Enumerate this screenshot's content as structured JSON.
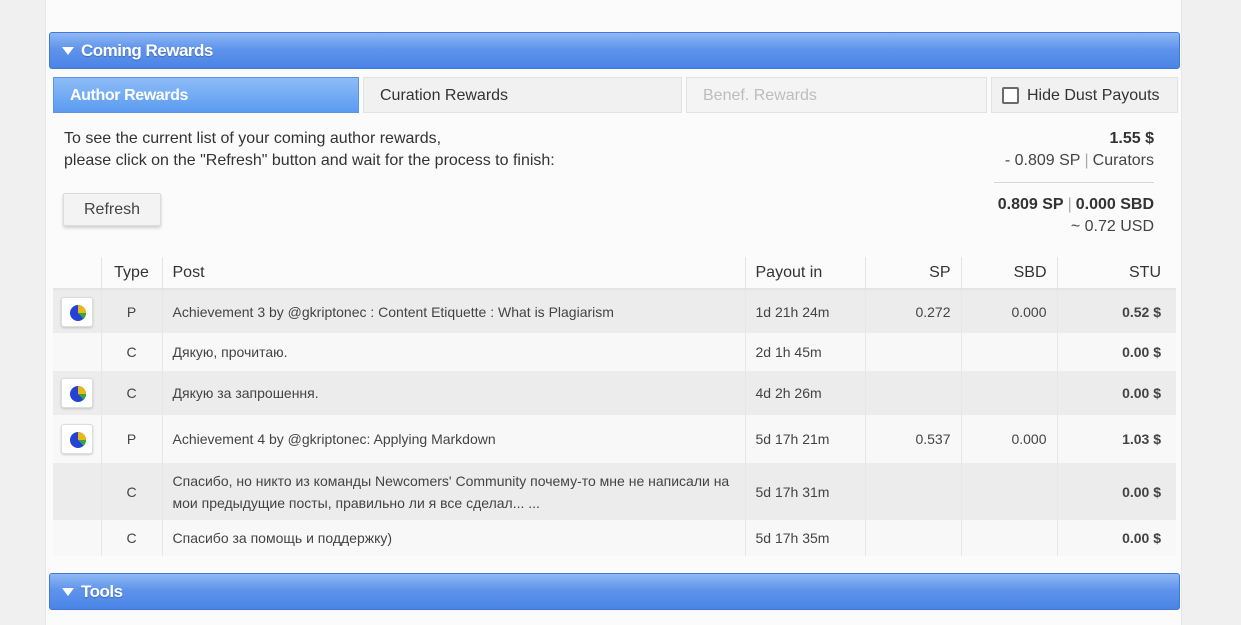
{
  "sections": {
    "coming_rewards": "Coming Rewards",
    "tools": "Tools"
  },
  "tabs": {
    "author": "Author Rewards",
    "curation": "Curation Rewards",
    "benef": "Benef. Rewards",
    "hide_dust": "Hide Dust Payouts"
  },
  "info": {
    "line1": "To see the current list of your coming author rewards,",
    "line2": "please click on the \"Refresh\" button and wait for the process to finish:"
  },
  "refresh_label": "Refresh",
  "totals": {
    "total_usd": "1.55 $",
    "curators_sp": "- 0.809 SP",
    "curators_label": "Curators",
    "sp": "0.809 SP",
    "sbd": "0.000 SBD",
    "usd_approx": "~ 0.72 USD"
  },
  "table": {
    "headers": {
      "type": "Type",
      "post": "Post",
      "payout": "Payout in",
      "sp": "SP",
      "sbd": "SBD",
      "stu": "STU"
    },
    "rows": [
      {
        "icon": "pie-chart-icon",
        "type": "P",
        "post": "Achievement 3 by @gkriptonec : Content Etiquette : What is Plagiarism",
        "payout": "1d 21h 24m",
        "sp": "0.272",
        "sbd": "0.000",
        "stu": "0.52 $"
      },
      {
        "icon": "",
        "type": "C",
        "post": "Дякую, прочитаю.",
        "payout": "2d 1h 45m",
        "sp": "",
        "sbd": "",
        "stu": "0.00 $"
      },
      {
        "icon": "pie-chart-icon",
        "type": "C",
        "post": "Дякую за запрошення.",
        "payout": "4d 2h 26m",
        "sp": "",
        "sbd": "",
        "stu": "0.00 $"
      },
      {
        "icon": "pie-chart-icon",
        "type": "P",
        "post": "Achievement 4 by @gkriptonec: Applying Markdown",
        "payout": "5d 17h 21m",
        "sp": "0.537",
        "sbd": "0.000",
        "stu": "1.03 $"
      },
      {
        "icon": "",
        "type": "C",
        "post": "Спасибо, но никто из команды Newcomers' Community почему-то мне не написали на мои предыдущие посты, правильно ли я все сделал... ...",
        "payout": "5d 17h 31m",
        "sp": "",
        "sbd": "",
        "stu": "0.00 $"
      },
      {
        "icon": "",
        "type": "C",
        "post": "Спасибо за помощь и поддержку)",
        "payout": "5d 17h 35m",
        "sp": "",
        "sbd": "",
        "stu": "0.00 $"
      }
    ]
  },
  "colors": {
    "section_bar": "#4a84e6",
    "active_tab": "#5b9bf0",
    "payout_header": "#2ab52a",
    "post_link": "#2c54a8"
  }
}
